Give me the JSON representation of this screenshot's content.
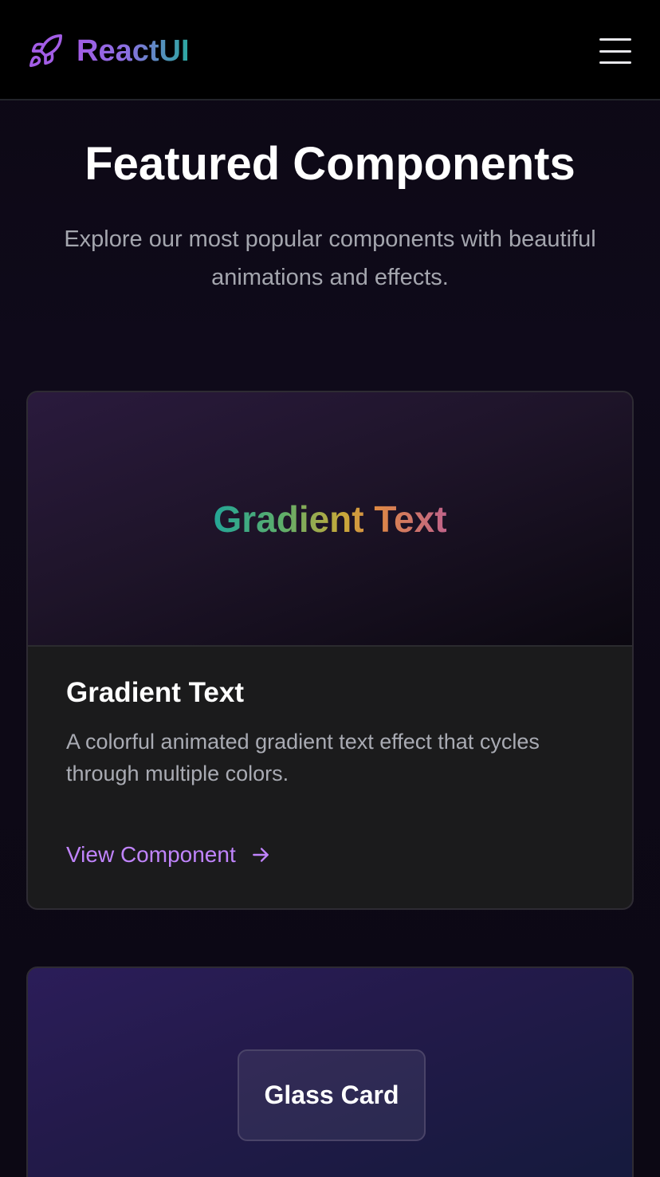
{
  "header": {
    "brand": "ReactUI",
    "logo_icon": "rocket-icon",
    "menu_icon": "hamburger-menu-icon"
  },
  "hero": {
    "title": "Featured Components",
    "subtitle": "Explore our most popular components with beautiful animations and effects."
  },
  "cards": [
    {
      "preview_text": "Gradient Text",
      "title": "Gradient Text",
      "description": "A colorful animated gradient text effect that cycles through multiple colors.",
      "link_label": "View Component",
      "link_icon": "arrow-right-icon"
    },
    {
      "preview_text": "Glass Card"
    }
  ],
  "colors": {
    "accent": "#c084fc",
    "background": "#0c0814",
    "card_body": "#1b1b1c"
  }
}
